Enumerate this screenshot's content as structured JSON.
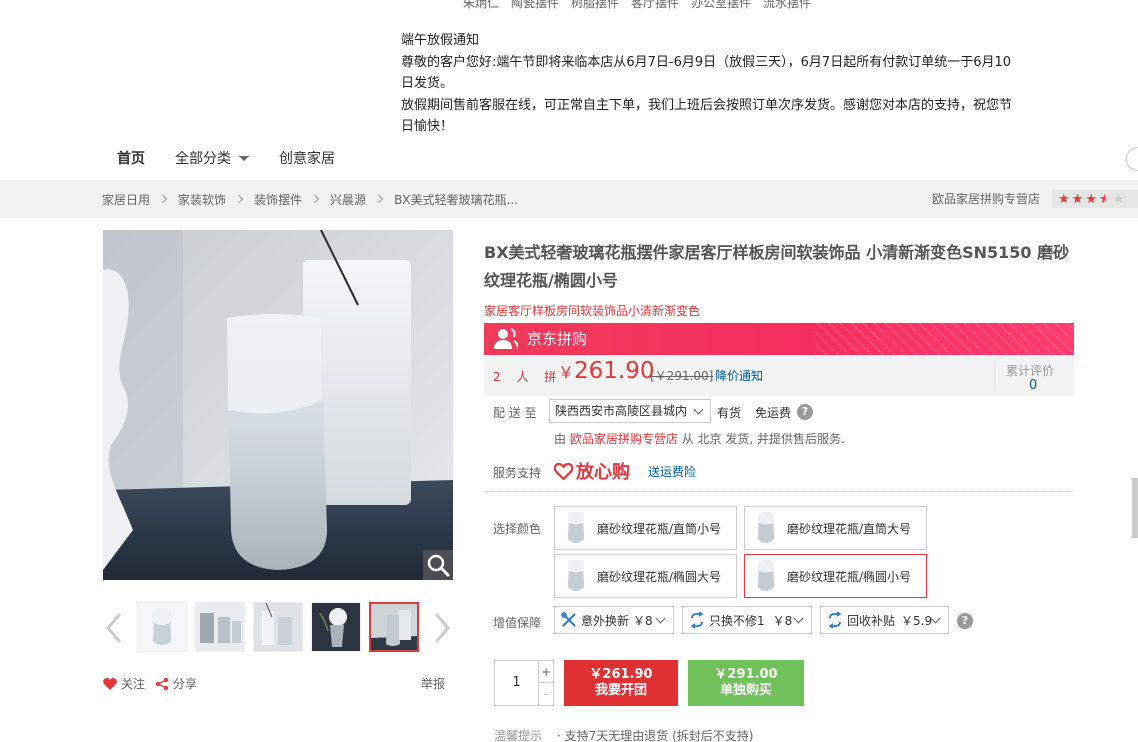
{
  "top_keywords": [
    "朱炳仁",
    "陶瓷摆件",
    "树脂摆件",
    "客厅摆件",
    "办公室摆件",
    "流水摆件"
  ],
  "notice": {
    "title": "端午放假通知",
    "line1": "尊敬的客户您好:端午节即将来临本店从6月7日-6月9日（放假三天），6月7日起所有付款订单统一于6月10日发货。",
    "line2": "放假期间售前客服在线，可正常自主下单，我们上班后会按照订单次序发货。感谢您对本店的支持，祝您节日愉快！"
  },
  "nav": {
    "home": "首页",
    "all_categories": "全部分类",
    "creative_home": "创意家居"
  },
  "breadcrumb": [
    "家居日用",
    "家装软饰",
    "装饰摆件",
    "兴晨源",
    "BX美式轻奢玻璃花瓶..."
  ],
  "shop": {
    "name": "欧品家居拼购专营店",
    "rating": 3.5
  },
  "gallery": {
    "active_index": 4,
    "thumb_count": 5
  },
  "actions": {
    "follow": "关注",
    "share": "分享",
    "report": "举报"
  },
  "product": {
    "title": "BX美式轻奢玻璃花瓶摆件家居客厅样板房间软装饰品 小清新渐变色SN5150 磨砂纹理花瓶/椭圆小号",
    "subtitle": "家居客厅样板房间软装饰品小清新渐变色"
  },
  "pingou": {
    "label": "京东拼购",
    "group_size": "2 人 拼",
    "currency": "￥",
    "price": "261.90",
    "old_price": "[￥291.00]",
    "price_notify": "降价通知",
    "review_label": "累计评价",
    "review_count": "0"
  },
  "delivery": {
    "label": "配 送 至",
    "address": "陕西西安市高陵区县城内",
    "stock": "有货",
    "free_shipping": "免运费",
    "ship_prefix": "由",
    "ship_shop": "欧品家居拼购专营店",
    "ship_suffix": "从 北京 发货, 并提供售后服务."
  },
  "service": {
    "label": "服务支持",
    "fangxin": "放心购",
    "yunfei": "送运费险"
  },
  "colors": {
    "label": "选择颜色",
    "options": [
      "磨砂纹理花瓶/直筒小号",
      "磨砂纹理花瓶/直筒大号",
      "磨砂纹理花瓶/椭圆大号",
      "磨砂纹理花瓶/椭圆小号"
    ],
    "selected_index": 3
  },
  "guarantee": {
    "label": "增值保障",
    "items": [
      {
        "name": "意外换新",
        "price": "￥8"
      },
      {
        "name": "只换不修1",
        "price": "￥8"
      },
      {
        "name": "回收补贴",
        "price": "￥5.9"
      }
    ]
  },
  "purchase": {
    "quantity": "1",
    "plus": "+",
    "minus": "-",
    "group_price": "￥261.90",
    "group_label": "我要开团",
    "single_price": "￥291.00",
    "single_label": "单独购买"
  },
  "tips": {
    "label": "温馨提示",
    "text": "· 支持7天无理由退货 (拆封后不支持)"
  },
  "accent_colors": {
    "red": "#e4393c",
    "pink_banner": "#f52d5f",
    "green": "#71c15b",
    "link_blue": "#005ea7"
  }
}
